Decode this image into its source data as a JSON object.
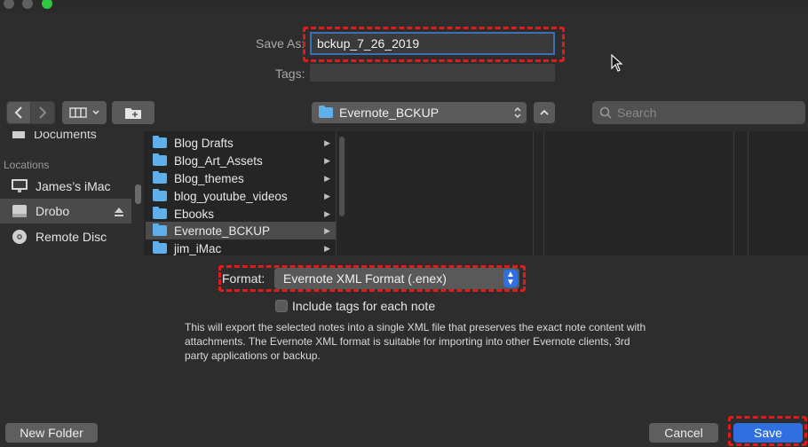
{
  "window": {
    "traffic_colors": [
      "#5f5f5f",
      "#5f5f5f",
      "#2fc840"
    ]
  },
  "save": {
    "save_as_label": "Save As:",
    "filename": "bckup_7_26_2019",
    "tags_label": "Tags:"
  },
  "toolbar": {
    "location_label": "Evernote_BCKUP",
    "search_placeholder": "Search"
  },
  "sidebar": {
    "partial_item": "Documents",
    "section_title": "Locations",
    "items": [
      {
        "label": "James’s iMac",
        "icon": "imac-icon"
      },
      {
        "label": "Drobo",
        "icon": "drive-icon",
        "selected": true
      },
      {
        "label": "Remote Disc",
        "icon": "disc-icon"
      }
    ]
  },
  "browser": {
    "folders": [
      {
        "name": "Blog Drafts"
      },
      {
        "name": "Blog_Art_Assets"
      },
      {
        "name": "Blog_themes"
      },
      {
        "name": "blog_youtube_videos"
      },
      {
        "name": "Ebooks"
      },
      {
        "name": "Evernote_BCKUP",
        "selected": true
      },
      {
        "name": "jim_iMac"
      }
    ]
  },
  "format": {
    "label": "Format:",
    "value": "Evernote XML Format (.enex)"
  },
  "options": {
    "include_tags_label": "Include tags for each note",
    "include_tags_checked": false
  },
  "description": "This will export the selected notes into a single XML file that preserves the exact note content with attachments. The Evernote XML format is suitable for importing into other Evernote clients, 3rd party applications or backup.",
  "buttons": {
    "new_folder": "New Folder",
    "cancel": "Cancel",
    "save": "Save"
  },
  "colors": {
    "accent": "#2f6fe0",
    "folder": "#5fb0ea",
    "highlight": "#e11a1a"
  }
}
